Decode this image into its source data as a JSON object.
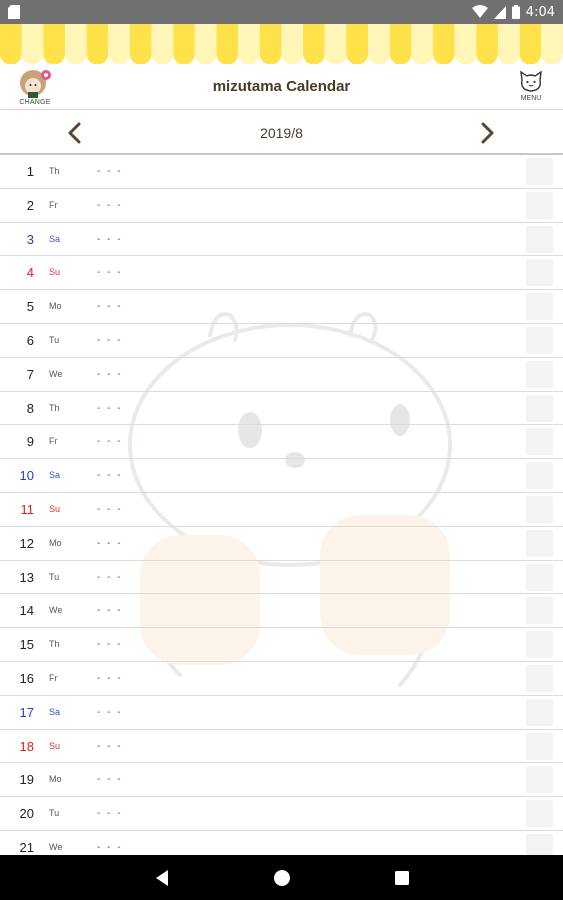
{
  "status_bar": {
    "time": "4:04",
    "icons": [
      "sd-card-icon",
      "wifi-icon",
      "signal-icon",
      "battery-icon"
    ]
  },
  "header": {
    "title": "mizutama Calendar",
    "change_label": "CHANGE",
    "menu_label": "MENU"
  },
  "month_nav": {
    "label": "2019/8"
  },
  "colors": {
    "awning_yellow": "#ffe24a",
    "awning_light": "#fff6b8",
    "title_brown": "#4a3a28",
    "saturday_blue": "#1f3fd0",
    "sunday_red": "#e02020"
  },
  "days": [
    {
      "day": "1",
      "weekday": "Th",
      "event": "- - -",
      "kind": "weekday"
    },
    {
      "day": "2",
      "weekday": "Fr",
      "event": "- - -",
      "kind": "weekday"
    },
    {
      "day": "3",
      "weekday": "Sa",
      "event": "- - -",
      "kind": "sat"
    },
    {
      "day": "4",
      "weekday": "Su",
      "event": "- - -",
      "kind": "sun"
    },
    {
      "day": "5",
      "weekday": "Mo",
      "event": "- - -",
      "kind": "weekday"
    },
    {
      "day": "6",
      "weekday": "Tu",
      "event": "- - -",
      "kind": "weekday"
    },
    {
      "day": "7",
      "weekday": "We",
      "event": "- - -",
      "kind": "weekday"
    },
    {
      "day": "8",
      "weekday": "Th",
      "event": "- - -",
      "kind": "weekday"
    },
    {
      "day": "9",
      "weekday": "Fr",
      "event": "- - -",
      "kind": "weekday"
    },
    {
      "day": "10",
      "weekday": "Sa",
      "event": "- - -",
      "kind": "sat"
    },
    {
      "day": "11",
      "weekday": "Su",
      "event": "- - -",
      "kind": "sun"
    },
    {
      "day": "12",
      "weekday": "Mo",
      "event": "- - -",
      "kind": "weekday"
    },
    {
      "day": "13",
      "weekday": "Tu",
      "event": "- - -",
      "kind": "weekday"
    },
    {
      "day": "14",
      "weekday": "We",
      "event": "- - -",
      "kind": "weekday"
    },
    {
      "day": "15",
      "weekday": "Th",
      "event": "- - -",
      "kind": "weekday"
    },
    {
      "day": "16",
      "weekday": "Fr",
      "event": "- - -",
      "kind": "weekday"
    },
    {
      "day": "17",
      "weekday": "Sa",
      "event": "- - -",
      "kind": "sat"
    },
    {
      "day": "18",
      "weekday": "Su",
      "event": "- - -",
      "kind": "sun"
    },
    {
      "day": "19",
      "weekday": "Mo",
      "event": "- - -",
      "kind": "weekday"
    },
    {
      "day": "20",
      "weekday": "Tu",
      "event": "- - -",
      "kind": "weekday"
    },
    {
      "day": "21",
      "weekday": "We",
      "event": "- - -",
      "kind": "weekday"
    }
  ]
}
